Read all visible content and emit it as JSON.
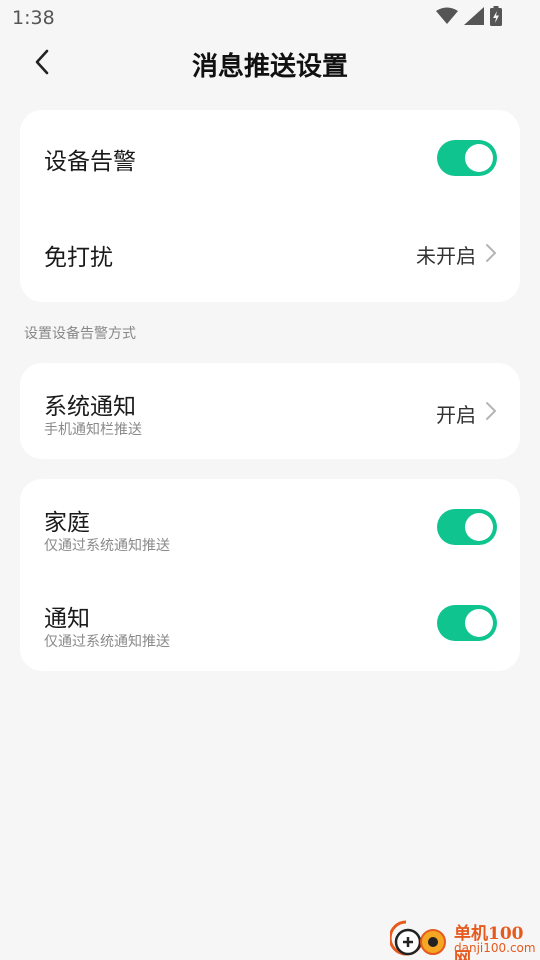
{
  "status_bar": {
    "time": "1:38"
  },
  "header": {
    "title": "消息推送设置"
  },
  "alarm_card": {
    "device_alarm": {
      "label": "设备告警",
      "enabled": true
    },
    "do_not_disturb": {
      "label": "免打扰",
      "value": "未开启"
    }
  },
  "section_label": "设置设备告警方式",
  "system_card": {
    "label": "系统通知",
    "subtitle": "手机通知栏推送",
    "value": "开启"
  },
  "category_card": {
    "items": [
      {
        "label": "家庭",
        "subtitle": "仅通过系统通知推送",
        "enabled": true
      },
      {
        "label": "通知",
        "subtitle": "仅通过系统通知推送",
        "enabled": true
      }
    ]
  },
  "watermark": {
    "name": "单机100网",
    "url": "danji100.com"
  },
  "colors": {
    "accent": "#10c48f",
    "background": "#f6f6f6",
    "card": "#ffffff",
    "watermark": "#e65a1e"
  }
}
